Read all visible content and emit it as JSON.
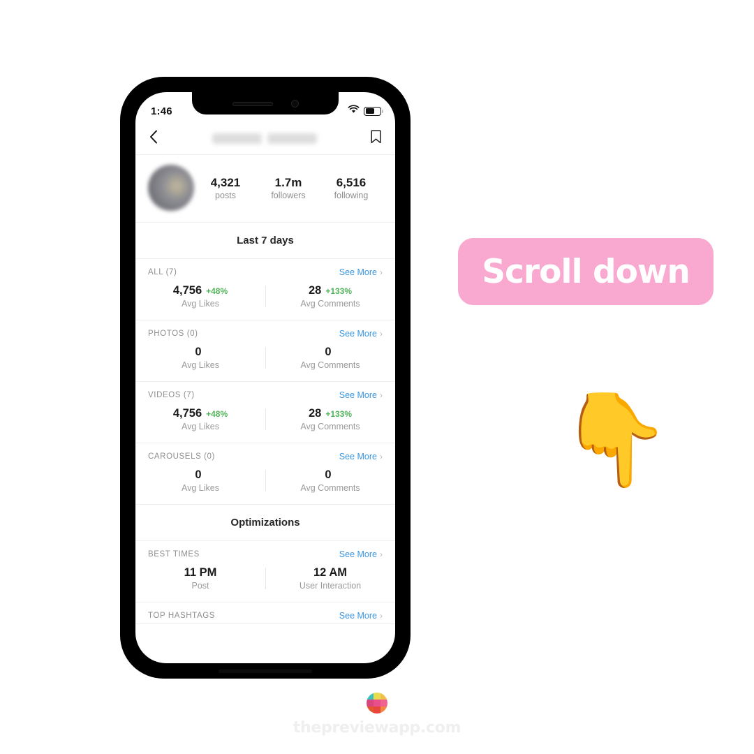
{
  "status_bar": {
    "time": "1:46",
    "wifi_icon": "wifi-icon",
    "battery_icon": "battery-icon"
  },
  "nav": {
    "back_icon": "chevron-left-icon",
    "username": "",
    "bookmark_icon": "bookmark-icon"
  },
  "profile": {
    "avatar": "profile-avatar",
    "stats": [
      {
        "num": "4,321",
        "label": "posts"
      },
      {
        "num": "1.7m",
        "label": "followers"
      },
      {
        "num": "6,516",
        "label": "following"
      }
    ]
  },
  "sections": [
    {
      "title": "Last 7 days"
    },
    {
      "title": "Optimizations"
    }
  ],
  "see_more_label": "See More",
  "chevron": "›",
  "groups": [
    {
      "key": "all",
      "label": "ALL (7)",
      "metrics": [
        {
          "value": "4,756",
          "delta": "+48%",
          "caption": "Avg Likes"
        },
        {
          "value": "28",
          "delta": "+133%",
          "caption": "Avg Comments"
        }
      ]
    },
    {
      "key": "photos",
      "label": "PHOTOS (0)",
      "metrics": [
        {
          "value": "0",
          "delta": "",
          "caption": "Avg Likes"
        },
        {
          "value": "0",
          "delta": "",
          "caption": "Avg Comments"
        }
      ]
    },
    {
      "key": "videos",
      "label": "VIDEOS (7)",
      "metrics": [
        {
          "value": "4,756",
          "delta": "+48%",
          "caption": "Avg Likes"
        },
        {
          "value": "28",
          "delta": "+133%",
          "caption": "Avg Comments"
        }
      ]
    },
    {
      "key": "carousels",
      "label": "CAROUSELS (0)",
      "metrics": [
        {
          "value": "0",
          "delta": "",
          "caption": "Avg Likes"
        },
        {
          "value": "0",
          "delta": "",
          "caption": "Avg Comments"
        }
      ]
    },
    {
      "key": "best-times",
      "label": "BEST TIMES",
      "metrics": [
        {
          "value": "11 PM",
          "delta": "",
          "caption": "Post"
        },
        {
          "value": "12 AM",
          "delta": "",
          "caption": "User Interaction"
        }
      ]
    },
    {
      "key": "top-hashtags",
      "label": "TOP HASHTAGS",
      "metrics": []
    }
  ],
  "overlay": {
    "scroll_label": "Scroll down",
    "hand_emoji": "👇"
  },
  "footer": {
    "brand_text": "thepreviewapp.com",
    "logo": "preview-app-logo"
  },
  "colors": {
    "badge_pink": "#F9A8D0",
    "link_blue": "#3A96E0",
    "delta_green": "#52B45A",
    "muted_grey": "#8E8E8E",
    "text_dark": "#1A1A1A",
    "footer_grey": "#EFEFEF"
  },
  "logo_swatches": [
    "#3FC1C0",
    "#E8DD4E",
    "#F0C04A",
    "#D9467F",
    "#E94F8A",
    "#F06292",
    "#E4572E",
    "#E8453C",
    "#F2863F"
  ]
}
